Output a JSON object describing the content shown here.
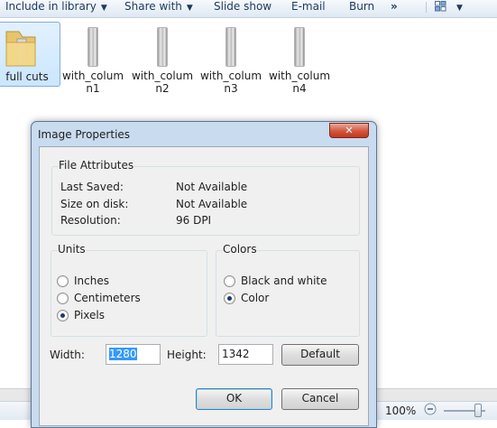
{
  "toolbar": {
    "include_library": "Include in library",
    "share_with": "Share with",
    "slide_show": "Slide show",
    "email": "E-mail",
    "burn": "Burn",
    "more": "»"
  },
  "files": [
    {
      "label": "full cuts",
      "icon": "folder-icon",
      "selected": true
    },
    {
      "label": "with_colum n1",
      "icon": "image-thumbnail-icon"
    },
    {
      "label": "with_colum n2",
      "icon": "image-thumbnail-icon"
    },
    {
      "label": "with_colum n3",
      "icon": "image-thumbnail-icon"
    },
    {
      "label": "with_colum n4",
      "icon": "image-thumbnail-icon"
    }
  ],
  "status": {
    "zoom": "100%"
  },
  "dialog": {
    "title": "Image Properties",
    "close": "✕",
    "file_attributes": {
      "label": "File Attributes",
      "last_saved_label": "Last Saved:",
      "last_saved_value": "Not Available",
      "size_label": "Size on disk:",
      "size_value": "Not Available",
      "resolution_label": "Resolution:",
      "resolution_value": "96 DPI"
    },
    "units": {
      "label": "Units",
      "options": [
        "Inches",
        "Centimeters",
        "Pixels"
      ],
      "selected": "Pixels"
    },
    "colors": {
      "label": "Colors",
      "options": [
        "Black and white",
        "Color"
      ],
      "selected": "Color"
    },
    "width_label": "Width:",
    "width_value": "1280",
    "height_label": "Height:",
    "height_value": "1342",
    "default_button": "Default",
    "ok_button": "OK",
    "cancel_button": "Cancel"
  }
}
